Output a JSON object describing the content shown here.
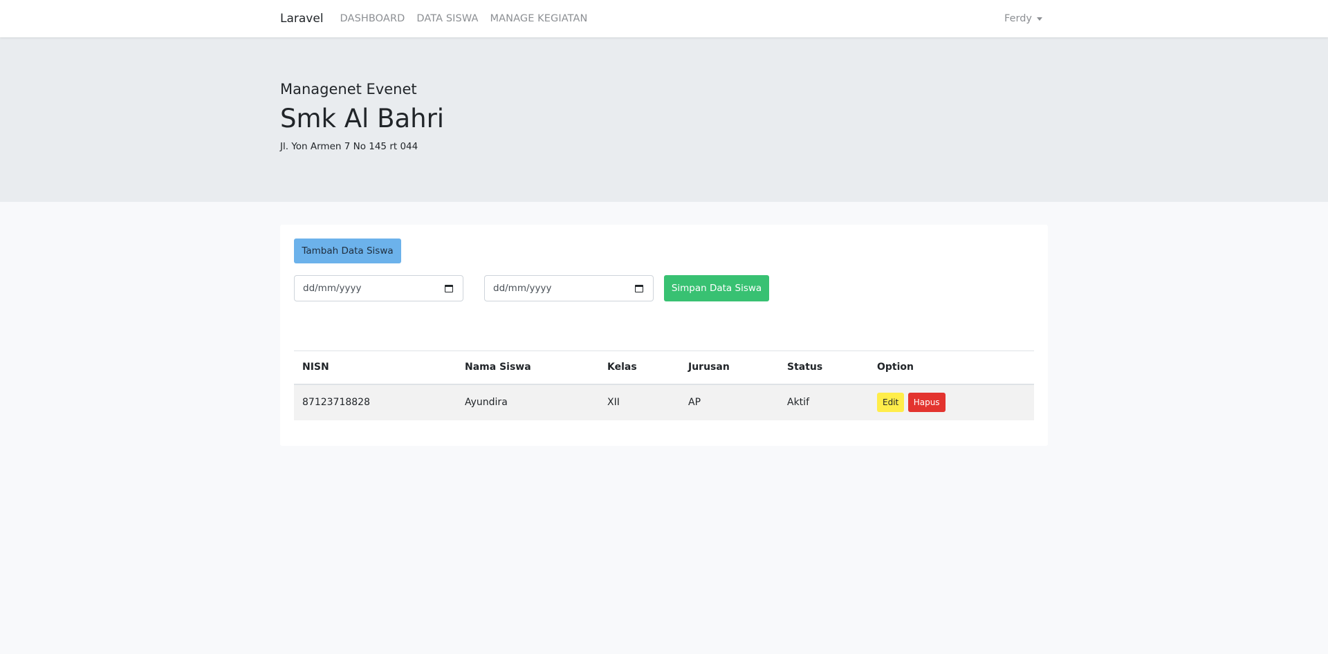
{
  "navbar": {
    "brand": "Laravel",
    "links": [
      "DASHBOARD",
      "DATA SISWA",
      "MANAGE KEGIATAN"
    ],
    "user": "Ferdy"
  },
  "header": {
    "subtitle": "Managenet Evenet",
    "title": "Smk Al Bahri",
    "address": "Jl. Yon Armen 7 No 145 rt 044"
  },
  "actions": {
    "add_label": "Tambah Data Siswa",
    "date_start_placeholder": "dd/mm/yyyy",
    "date_end_placeholder": "dd/mm/yyyy",
    "save_label": "Simpan Data Siswa"
  },
  "table": {
    "headers": [
      "NISN",
      "Nama Siswa",
      "Kelas",
      "Jurusan",
      "Status",
      "Option"
    ],
    "rows": [
      {
        "nisn": "87123718828",
        "nama": "Ayundira",
        "kelas": "XII",
        "jurusan": "AP",
        "status": "Aktif",
        "edit_label": "Edit",
        "delete_label": "Hapus"
      }
    ]
  },
  "colors": {
    "add_button": "#6cb2eb",
    "save_button": "#38c172",
    "edit_button": "#ffed4a",
    "delete_button": "#e3342f"
  }
}
